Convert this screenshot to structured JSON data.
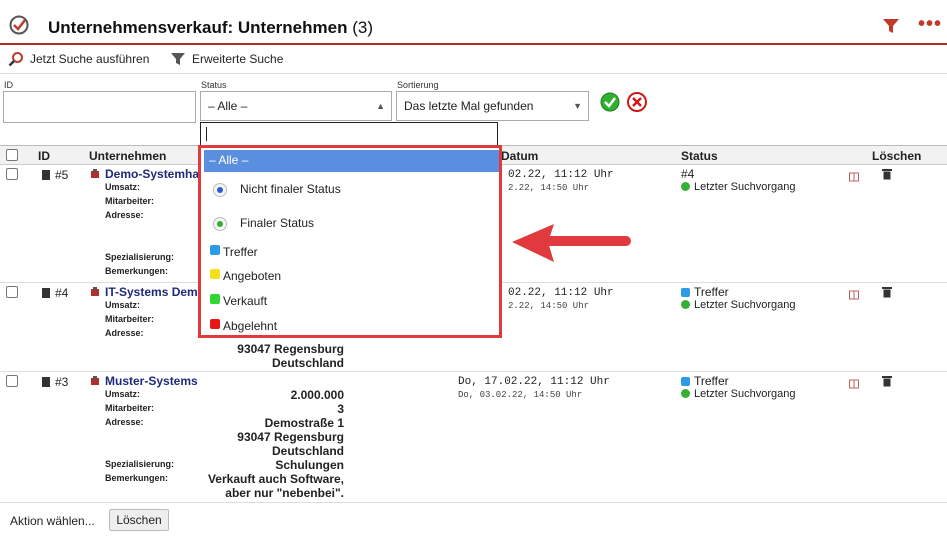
{
  "header": {
    "title": "Unternehmensverkauf: Unternehmen",
    "count": "(3)"
  },
  "toolbar": {
    "search_label": "Jetzt Suche ausführen",
    "advanced_label": "Erweiterte Suche"
  },
  "filters": {
    "id_label": "ID",
    "status_label": "Status",
    "status_value": "– Alle –",
    "sort_label": "Sortierung",
    "sort_value": "Das letzte Mal gefunden"
  },
  "table": {
    "headers": {
      "id": "ID",
      "company": "Unternehmen",
      "date": "Datum",
      "status": "Status",
      "delete": "Löschen"
    },
    "field_labels": {
      "umsatz": "Umsatz:",
      "mitarbeiter": "Mitarbeiter:",
      "adresse": "Adresse:",
      "spezialisierung": "Spezialisierung:",
      "bemerkungen": "Bemerkungen:"
    },
    "rows": [
      {
        "id": "#5",
        "company": "Demo-Systemha",
        "date1": "02.22, 11:12 Uhr",
        "date2": "2.22, 14:50 Uhr",
        "status1": "#4",
        "status2": "Letzter Suchvorgang"
      },
      {
        "id": "#4",
        "company": "IT-Systems Dem",
        "date1": "02.22, 11:12 Uhr",
        "date2": "2.22, 14:50 Uhr",
        "status1": "Treffer",
        "status2": "Letzter Suchvorgang",
        "addr_city": "93047 Regensburg",
        "addr_country": "Deutschland"
      },
      {
        "id": "#3",
        "company": "Muster-Systems",
        "date1": "Do, 17.02.22, 11:12 Uhr",
        "date2": "Do, 03.02.22, 14:50 Uhr",
        "status1": "Treffer",
        "status2": "Letzter Suchvorgang",
        "umsatz": "2.000.000",
        "mitarbeiter": "3",
        "addr_street": "Demostraße 1",
        "addr_city": "93047 Regensburg",
        "addr_country": "Deutschland",
        "spezialisierung": "Schulungen",
        "bemerkungen1": "Verkauft auch Software,",
        "bemerkungen2": "aber nur \"nebenbei\"."
      }
    ]
  },
  "footer": {
    "action_label": "Aktion wählen...",
    "delete_button": "Löschen"
  },
  "dropdown": {
    "selected": "– Alle –",
    "groups": [
      {
        "label": "Nicht finaler Status"
      },
      {
        "label": "Finaler Status"
      }
    ],
    "statuses": [
      {
        "label": "Treffer",
        "color": "#2e9be6"
      },
      {
        "label": "Angeboten",
        "color": "#f2e21b"
      },
      {
        "label": "Verkauft",
        "color": "#33d633"
      },
      {
        "label": "Abgelehnt",
        "color": "#e81616"
      }
    ]
  },
  "colors": {
    "accent": "#b02a2a",
    "highlight": "#e03a3e",
    "link": "#1f2a7a",
    "selected": "#5a8fe0"
  }
}
